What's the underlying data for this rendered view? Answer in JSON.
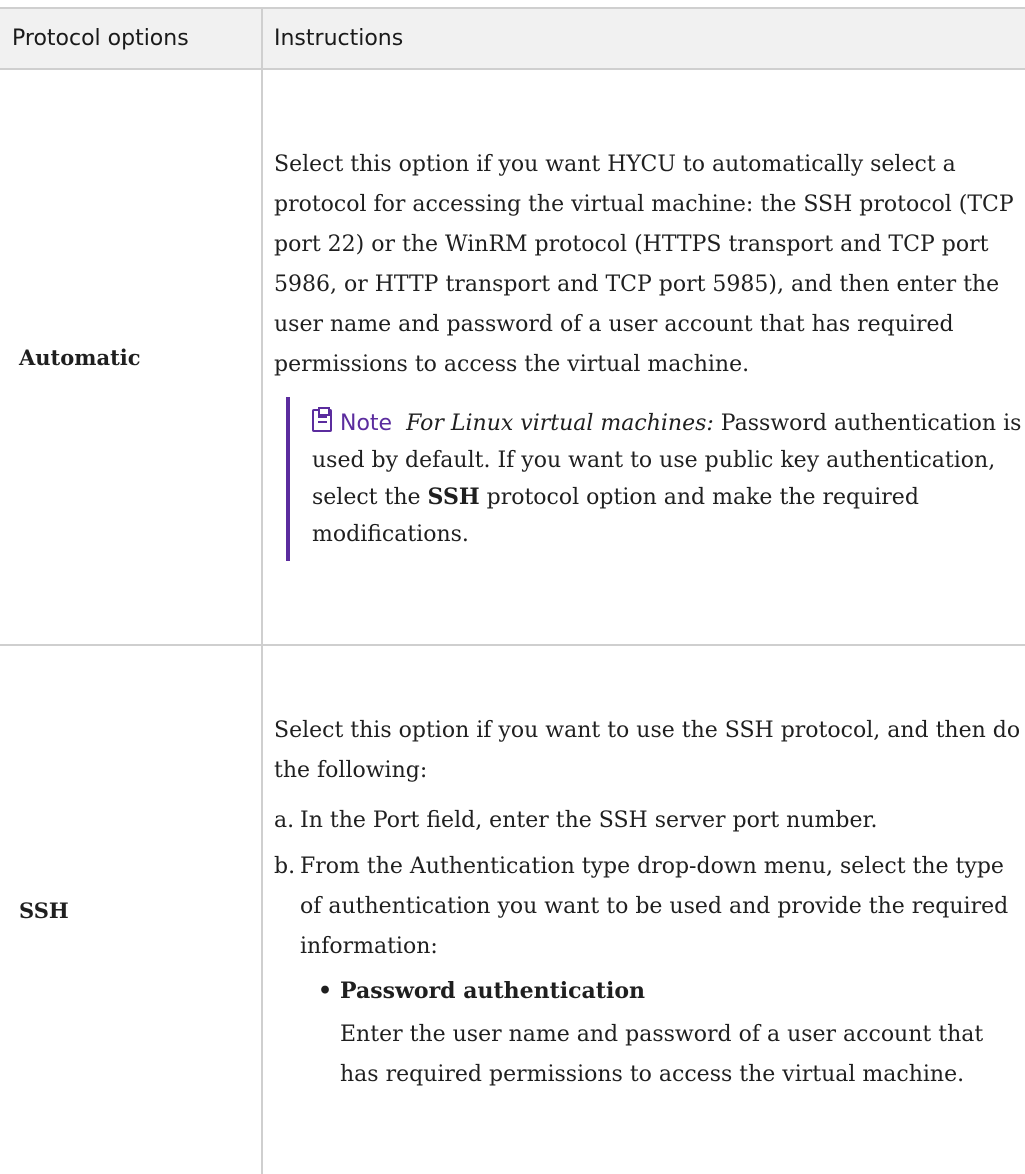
{
  "table": {
    "headers": [
      "Protocol options",
      "Instructions"
    ],
    "rows": {
      "automatic": {
        "option": "Automatic",
        "text": "Select this option if you want HYCU to automatically select a protocol for accessing the virtual machine: the SSH protocol (TCP port 22) or the WinRM protocol (HTTPS transport and TCP port 5986, or HTTP transport and TCP port 5985), and then enter the user name and password of a user account that has required permissions to access the virtual machine.",
        "note": {
          "icon": "clipboard-note-icon",
          "label": "Note",
          "em": "For Linux virtual machines:",
          "text_before": " Password authentication is used by default. If you want to use public key authentication, select the ",
          "bold": "SSH",
          "text_after": " protocol option and make the required modifications."
        }
      },
      "ssh": {
        "option": "SSH",
        "intro": "Select this option if you want to use the SSH protocol, and then do the following:",
        "steps": [
          {
            "marker": "a.",
            "text": "In the Port field, enter the SSH server port number."
          },
          {
            "marker": "b.",
            "text": "From the Authentication type drop-down menu, select the type of authentication you want to be used and provide the required information:"
          }
        ],
        "bullet": {
          "marker": "•",
          "title": "Password authentication",
          "text": "Enter the user name and password of a user account that has required permissions to access the virtual machine."
        }
      }
    }
  },
  "colors": {
    "accent": "#5b2c9e",
    "header_bg": "#f1f1f1",
    "border": "#cfcfcf"
  }
}
